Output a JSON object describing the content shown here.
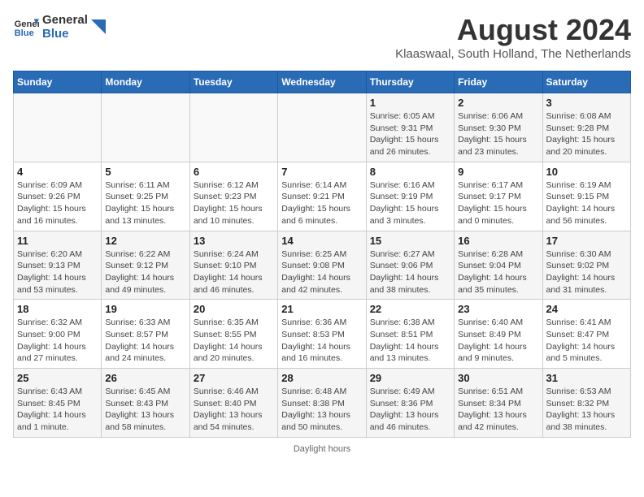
{
  "header": {
    "logo_line1": "General",
    "logo_line2": "Blue",
    "month_year": "August 2024",
    "location": "Klaaswaal, South Holland, The Netherlands"
  },
  "days_of_week": [
    "Sunday",
    "Monday",
    "Tuesday",
    "Wednesday",
    "Thursday",
    "Friday",
    "Saturday"
  ],
  "weeks": [
    [
      {
        "day": "",
        "info": ""
      },
      {
        "day": "",
        "info": ""
      },
      {
        "day": "",
        "info": ""
      },
      {
        "day": "",
        "info": ""
      },
      {
        "day": "1",
        "info": "Sunrise: 6:05 AM\nSunset: 9:31 PM\nDaylight: 15 hours and 26 minutes."
      },
      {
        "day": "2",
        "info": "Sunrise: 6:06 AM\nSunset: 9:30 PM\nDaylight: 15 hours and 23 minutes."
      },
      {
        "day": "3",
        "info": "Sunrise: 6:08 AM\nSunset: 9:28 PM\nDaylight: 15 hours and 20 minutes."
      }
    ],
    [
      {
        "day": "4",
        "info": "Sunrise: 6:09 AM\nSunset: 9:26 PM\nDaylight: 15 hours and 16 minutes."
      },
      {
        "day": "5",
        "info": "Sunrise: 6:11 AM\nSunset: 9:25 PM\nDaylight: 15 hours and 13 minutes."
      },
      {
        "day": "6",
        "info": "Sunrise: 6:12 AM\nSunset: 9:23 PM\nDaylight: 15 hours and 10 minutes."
      },
      {
        "day": "7",
        "info": "Sunrise: 6:14 AM\nSunset: 9:21 PM\nDaylight: 15 hours and 6 minutes."
      },
      {
        "day": "8",
        "info": "Sunrise: 6:16 AM\nSunset: 9:19 PM\nDaylight: 15 hours and 3 minutes."
      },
      {
        "day": "9",
        "info": "Sunrise: 6:17 AM\nSunset: 9:17 PM\nDaylight: 15 hours and 0 minutes."
      },
      {
        "day": "10",
        "info": "Sunrise: 6:19 AM\nSunset: 9:15 PM\nDaylight: 14 hours and 56 minutes."
      }
    ],
    [
      {
        "day": "11",
        "info": "Sunrise: 6:20 AM\nSunset: 9:13 PM\nDaylight: 14 hours and 53 minutes."
      },
      {
        "day": "12",
        "info": "Sunrise: 6:22 AM\nSunset: 9:12 PM\nDaylight: 14 hours and 49 minutes."
      },
      {
        "day": "13",
        "info": "Sunrise: 6:24 AM\nSunset: 9:10 PM\nDaylight: 14 hours and 46 minutes."
      },
      {
        "day": "14",
        "info": "Sunrise: 6:25 AM\nSunset: 9:08 PM\nDaylight: 14 hours and 42 minutes."
      },
      {
        "day": "15",
        "info": "Sunrise: 6:27 AM\nSunset: 9:06 PM\nDaylight: 14 hours and 38 minutes."
      },
      {
        "day": "16",
        "info": "Sunrise: 6:28 AM\nSunset: 9:04 PM\nDaylight: 14 hours and 35 minutes."
      },
      {
        "day": "17",
        "info": "Sunrise: 6:30 AM\nSunset: 9:02 PM\nDaylight: 14 hours and 31 minutes."
      }
    ],
    [
      {
        "day": "18",
        "info": "Sunrise: 6:32 AM\nSunset: 9:00 PM\nDaylight: 14 hours and 27 minutes."
      },
      {
        "day": "19",
        "info": "Sunrise: 6:33 AM\nSunset: 8:57 PM\nDaylight: 14 hours and 24 minutes."
      },
      {
        "day": "20",
        "info": "Sunrise: 6:35 AM\nSunset: 8:55 PM\nDaylight: 14 hours and 20 minutes."
      },
      {
        "day": "21",
        "info": "Sunrise: 6:36 AM\nSunset: 8:53 PM\nDaylight: 14 hours and 16 minutes."
      },
      {
        "day": "22",
        "info": "Sunrise: 6:38 AM\nSunset: 8:51 PM\nDaylight: 14 hours and 13 minutes."
      },
      {
        "day": "23",
        "info": "Sunrise: 6:40 AM\nSunset: 8:49 PM\nDaylight: 14 hours and 9 minutes."
      },
      {
        "day": "24",
        "info": "Sunrise: 6:41 AM\nSunset: 8:47 PM\nDaylight: 14 hours and 5 minutes."
      }
    ],
    [
      {
        "day": "25",
        "info": "Sunrise: 6:43 AM\nSunset: 8:45 PM\nDaylight: 14 hours and 1 minute."
      },
      {
        "day": "26",
        "info": "Sunrise: 6:45 AM\nSunset: 8:43 PM\nDaylight: 13 hours and 58 minutes."
      },
      {
        "day": "27",
        "info": "Sunrise: 6:46 AM\nSunset: 8:40 PM\nDaylight: 13 hours and 54 minutes."
      },
      {
        "day": "28",
        "info": "Sunrise: 6:48 AM\nSunset: 8:38 PM\nDaylight: 13 hours and 50 minutes."
      },
      {
        "day": "29",
        "info": "Sunrise: 6:49 AM\nSunset: 8:36 PM\nDaylight: 13 hours and 46 minutes."
      },
      {
        "day": "30",
        "info": "Sunrise: 6:51 AM\nSunset: 8:34 PM\nDaylight: 13 hours and 42 minutes."
      },
      {
        "day": "31",
        "info": "Sunrise: 6:53 AM\nSunset: 8:32 PM\nDaylight: 13 hours and 38 minutes."
      }
    ]
  ],
  "footer": {
    "daylight_label": "Daylight hours"
  }
}
